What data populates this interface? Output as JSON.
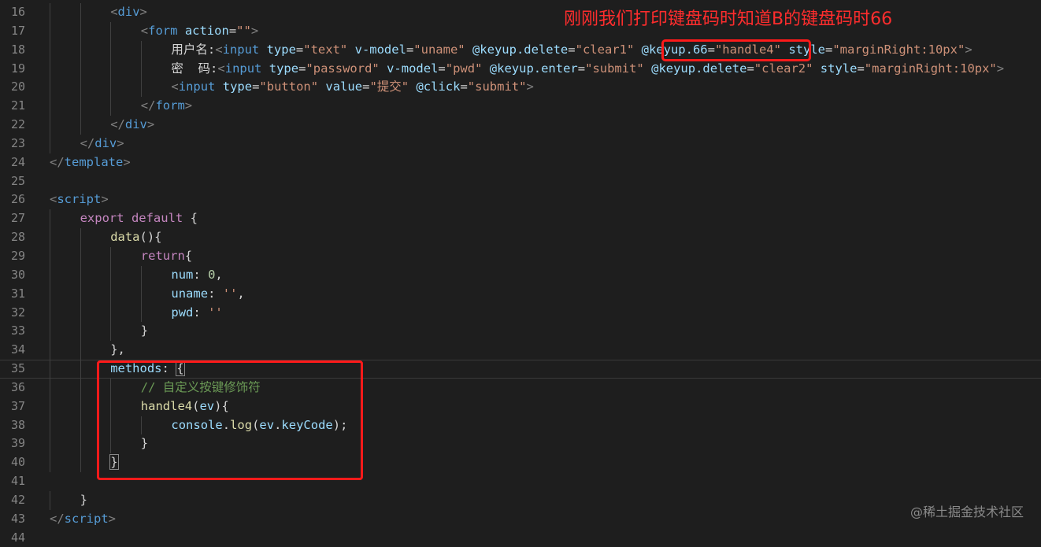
{
  "annotation": "刚刚我们打印键盘码时知道B的键盘码时66",
  "watermark": "@稀土掘金技术社区",
  "lines": [
    {
      "n": "16",
      "indent": 2,
      "tokens": [
        [
          "tk-br",
          "<"
        ],
        [
          "tk-tag",
          "div"
        ],
        [
          "tk-br",
          ">"
        ]
      ]
    },
    {
      "n": "17",
      "indent": 3,
      "tokens": [
        [
          "tk-br",
          "<"
        ],
        [
          "tk-tag",
          "form"
        ],
        [
          "tk-txt",
          " "
        ],
        [
          "tk-attr",
          "action"
        ],
        [
          "tk-txt",
          "="
        ],
        [
          "tk-str",
          "\"\""
        ],
        [
          "tk-br",
          ">"
        ]
      ]
    },
    {
      "n": "18",
      "indent": 4,
      "tokens": [
        [
          "tk-txt",
          "用户名:"
        ],
        [
          "tk-br",
          "<"
        ],
        [
          "tk-tag",
          "input"
        ],
        [
          "tk-txt",
          " "
        ],
        [
          "tk-attr",
          "type"
        ],
        [
          "tk-txt",
          "="
        ],
        [
          "tk-str",
          "\"text\""
        ],
        [
          "tk-txt",
          " "
        ],
        [
          "tk-attr",
          "v-model"
        ],
        [
          "tk-txt",
          "="
        ],
        [
          "tk-str",
          "\"uname\""
        ],
        [
          "tk-txt",
          " "
        ],
        [
          "tk-attr",
          "@keyup.delete"
        ],
        [
          "tk-txt",
          "="
        ],
        [
          "tk-str",
          "\"clear1\""
        ],
        [
          "tk-txt",
          " "
        ],
        [
          "tk-attr",
          "@keyup.66"
        ],
        [
          "tk-txt",
          "="
        ],
        [
          "tk-str",
          "\"handle4\""
        ],
        [
          "tk-txt",
          " "
        ],
        [
          "tk-attr",
          "style"
        ],
        [
          "tk-txt",
          "="
        ],
        [
          "tk-str",
          "\"marginRight:10px\""
        ],
        [
          "tk-br",
          ">"
        ]
      ]
    },
    {
      "n": "19",
      "indent": 4,
      "tokens": [
        [
          "tk-txt",
          "密  码:"
        ],
        [
          "tk-br",
          "<"
        ],
        [
          "tk-tag",
          "input"
        ],
        [
          "tk-txt",
          " "
        ],
        [
          "tk-attr",
          "type"
        ],
        [
          "tk-txt",
          "="
        ],
        [
          "tk-str",
          "\"password\""
        ],
        [
          "tk-txt",
          " "
        ],
        [
          "tk-attr",
          "v-model"
        ],
        [
          "tk-txt",
          "="
        ],
        [
          "tk-str",
          "\"pwd\""
        ],
        [
          "tk-txt",
          " "
        ],
        [
          "tk-attr",
          "@keyup.enter"
        ],
        [
          "tk-txt",
          "="
        ],
        [
          "tk-str",
          "\"submit\""
        ],
        [
          "tk-txt",
          " "
        ],
        [
          "tk-attr",
          "@keyup.delete"
        ],
        [
          "tk-txt",
          "="
        ],
        [
          "tk-str",
          "\"clear2\""
        ],
        [
          "tk-txt",
          " "
        ],
        [
          "tk-attr",
          "style"
        ],
        [
          "tk-txt",
          "="
        ],
        [
          "tk-str",
          "\"marginRight:10px\""
        ],
        [
          "tk-br",
          ">"
        ]
      ]
    },
    {
      "n": "20",
      "indent": 4,
      "tokens": [
        [
          "tk-br",
          "<"
        ],
        [
          "tk-tag",
          "input"
        ],
        [
          "tk-txt",
          " "
        ],
        [
          "tk-attr",
          "type"
        ],
        [
          "tk-txt",
          "="
        ],
        [
          "tk-str",
          "\"button\""
        ],
        [
          "tk-txt",
          " "
        ],
        [
          "tk-attr",
          "value"
        ],
        [
          "tk-txt",
          "="
        ],
        [
          "tk-str",
          "\"提交\""
        ],
        [
          "tk-txt",
          " "
        ],
        [
          "tk-attr",
          "@click"
        ],
        [
          "tk-txt",
          "="
        ],
        [
          "tk-str",
          "\"submit\""
        ],
        [
          "tk-br",
          ">"
        ]
      ]
    },
    {
      "n": "21",
      "indent": 3,
      "tokens": [
        [
          "tk-br",
          "</"
        ],
        [
          "tk-tag",
          "form"
        ],
        [
          "tk-br",
          ">"
        ]
      ]
    },
    {
      "n": "22",
      "indent": 2,
      "tokens": [
        [
          "tk-br",
          "</"
        ],
        [
          "tk-tag",
          "div"
        ],
        [
          "tk-br",
          ">"
        ]
      ]
    },
    {
      "n": "23",
      "indent": 1,
      "tokens": [
        [
          "tk-br",
          "</"
        ],
        [
          "tk-tag",
          "div"
        ],
        [
          "tk-br",
          ">"
        ]
      ]
    },
    {
      "n": "24",
      "indent": 0,
      "tokens": [
        [
          "tk-br",
          "</"
        ],
        [
          "tk-tag",
          "template"
        ],
        [
          "tk-br",
          ">"
        ]
      ]
    },
    {
      "n": "25",
      "indent": 0,
      "tokens": []
    },
    {
      "n": "26",
      "indent": 0,
      "tokens": [
        [
          "tk-br",
          "<"
        ],
        [
          "tk-tag",
          "script"
        ],
        [
          "tk-br",
          ">"
        ]
      ]
    },
    {
      "n": "27",
      "indent": 1,
      "tokens": [
        [
          "tk-kw",
          "export"
        ],
        [
          "tk-txt",
          " "
        ],
        [
          "tk-kw",
          "default"
        ],
        [
          "tk-txt",
          " {"
        ]
      ]
    },
    {
      "n": "28",
      "indent": 2,
      "tokens": [
        [
          "tk-fn",
          "data"
        ],
        [
          "tk-txt",
          "(){"
        ]
      ]
    },
    {
      "n": "29",
      "indent": 3,
      "tokens": [
        [
          "tk-kw",
          "return"
        ],
        [
          "tk-txt",
          "{"
        ]
      ]
    },
    {
      "n": "30",
      "indent": 4,
      "tokens": [
        [
          "tk-prop",
          "num"
        ],
        [
          "tk-txt",
          ": "
        ],
        [
          "tk-num",
          "0"
        ],
        [
          "tk-txt",
          ","
        ]
      ]
    },
    {
      "n": "31",
      "indent": 4,
      "tokens": [
        [
          "tk-prop",
          "uname"
        ],
        [
          "tk-txt",
          ": "
        ],
        [
          "tk-str",
          "''"
        ],
        [
          "tk-txt",
          ","
        ]
      ]
    },
    {
      "n": "32",
      "indent": 4,
      "tokens": [
        [
          "tk-prop",
          "pwd"
        ],
        [
          "tk-txt",
          ": "
        ],
        [
          "tk-str",
          "''"
        ]
      ]
    },
    {
      "n": "33",
      "indent": 3,
      "tokens": [
        [
          "tk-txt",
          "}"
        ]
      ]
    },
    {
      "n": "34",
      "indent": 2,
      "tokens": [
        [
          "tk-txt",
          "},"
        ]
      ]
    },
    {
      "n": "35",
      "indent": 2,
      "current": true,
      "tokens": [
        [
          "tk-prop",
          "methods"
        ],
        [
          "tk-txt",
          ": "
        ],
        [
          "tk-txt brace-match",
          "{"
        ]
      ]
    },
    {
      "n": "36",
      "indent": 3,
      "tokens": [
        [
          "tk-cmt",
          "// 自定义按键修饰符"
        ]
      ]
    },
    {
      "n": "37",
      "indent": 3,
      "tokens": [
        [
          "tk-fn",
          "handle4"
        ],
        [
          "tk-txt",
          "("
        ],
        [
          "tk-prop",
          "ev"
        ],
        [
          "tk-txt",
          "){"
        ]
      ]
    },
    {
      "n": "38",
      "indent": 4,
      "tokens": [
        [
          "tk-prop",
          "console"
        ],
        [
          "tk-txt",
          "."
        ],
        [
          "tk-fn",
          "log"
        ],
        [
          "tk-txt",
          "("
        ],
        [
          "tk-prop",
          "ev"
        ],
        [
          "tk-txt",
          "."
        ],
        [
          "tk-prop",
          "keyCode"
        ],
        [
          "tk-txt",
          ");"
        ]
      ]
    },
    {
      "n": "39",
      "indent": 3,
      "tokens": [
        [
          "tk-txt",
          "}"
        ]
      ]
    },
    {
      "n": "40",
      "indent": 2,
      "tokens": [
        [
          "tk-txt brace-match",
          "}"
        ]
      ]
    },
    {
      "n": "41",
      "indent": 0,
      "tokens": []
    },
    {
      "n": "42",
      "indent": 1,
      "tokens": [
        [
          "tk-txt",
          "}"
        ]
      ]
    },
    {
      "n": "43",
      "indent": 0,
      "tokens": [
        [
          "tk-br",
          "</"
        ],
        [
          "tk-tag",
          "script"
        ],
        [
          "tk-br",
          ">"
        ]
      ]
    },
    {
      "n": "44",
      "indent": 0,
      "tokens": []
    }
  ]
}
